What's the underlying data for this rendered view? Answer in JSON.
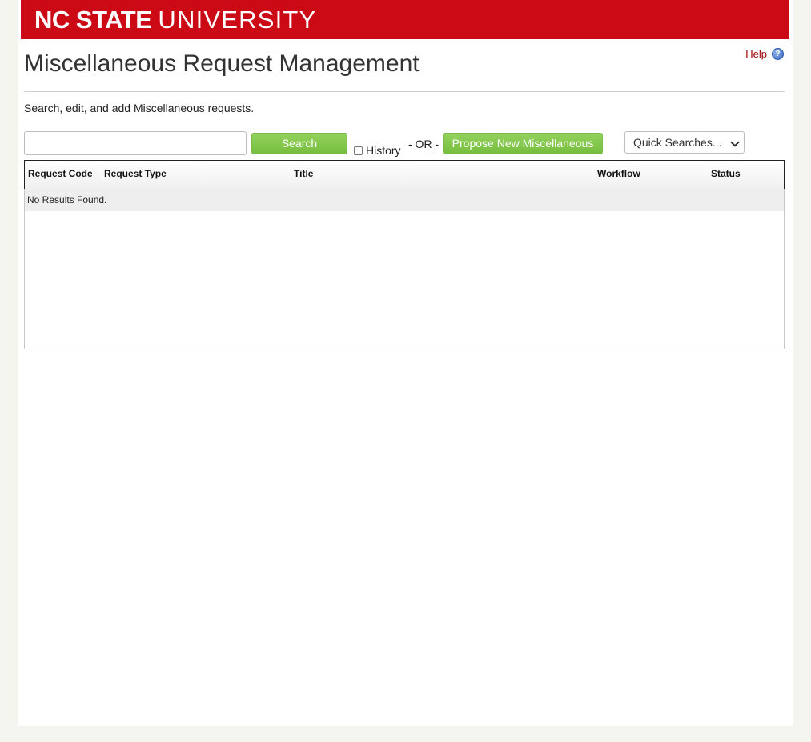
{
  "brand": {
    "logo_bold": "NC STATE",
    "logo_light": "UNIVERSITY"
  },
  "header": {
    "title": "Miscellaneous Request Management",
    "help_label": "Help",
    "subtitle": "Search, edit, and add Miscellaneous requests."
  },
  "toolbar": {
    "search_value": "",
    "search_placeholder": "",
    "search_button": "Search",
    "history_label": "History",
    "history_checked": false,
    "or_text": "- OR -",
    "propose_button": "Propose New Miscellaneous",
    "quick_searches_selected": "Quick Searches..."
  },
  "results": {
    "columns": [
      "Request Code",
      "Request Type",
      "Title",
      "Workflow",
      "Status"
    ],
    "empty_message": "No Results Found."
  },
  "colors": {
    "brand_red": "#cc0a16",
    "button_green": "#76bd3e",
    "help_link": "#990000"
  }
}
